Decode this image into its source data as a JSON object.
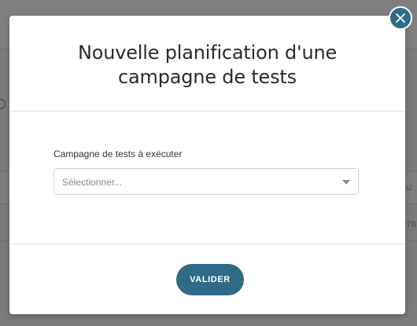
{
  "background": {
    "right_header_fragment": "LU",
    "right_row_fragment": "x76"
  },
  "modal": {
    "title": "Nouvelle planification d'une campagne de tests",
    "field_label": "Campagne de tests à exécuter",
    "select_placeholder": "Sélectionner...",
    "submit_label": "VALIDER",
    "close_icon": "close-icon"
  },
  "colors": {
    "accent": "#2f6b86",
    "overlay": "#7b7b7b",
    "title_text": "#2b2b2b",
    "placeholder_text": "#8a8a8a"
  }
}
